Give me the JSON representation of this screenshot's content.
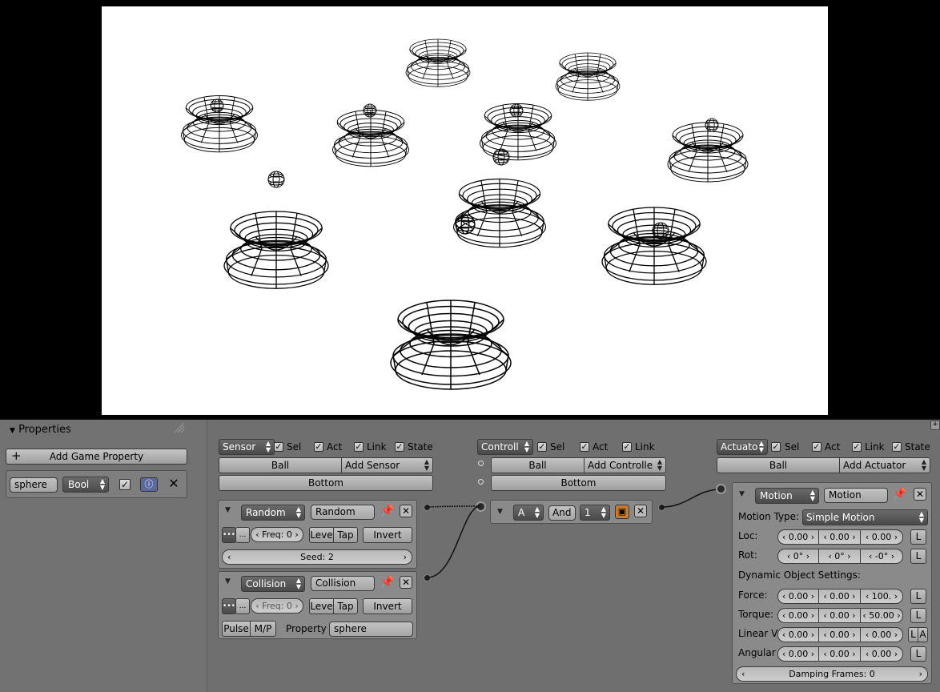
{
  "properties": {
    "title": "Properties",
    "add_button": "Add Game Property",
    "prop_name": "sphere",
    "prop_type": "Bool",
    "prop_value": true
  },
  "sensor": {
    "header_label": "Sensor",
    "sel": "Sel",
    "act": "Act",
    "link": "Link",
    "state": "State",
    "object": "Ball",
    "add": "Add Sensor",
    "sub": "Bottom",
    "items": [
      {
        "type": "Random",
        "name": "Random",
        "freq": "Freq: 0",
        "level": "Leve",
        "tap": "Tap",
        "invert": "Invert",
        "seed": "Seed: 2"
      },
      {
        "type": "Collision",
        "name": "Collision",
        "freq": "Freq: 0",
        "level": "Leve",
        "tap": "Tap",
        "invert": "Invert",
        "pulse": "Pulse",
        "mp": "M/P",
        "prop_label": "Property",
        "prop_value": "sphere"
      }
    ]
  },
  "controller": {
    "header_label": "Controll",
    "sel": "Sel",
    "act": "Act",
    "link": "Link",
    "object": "Ball",
    "add": "Add Controlle",
    "sub": "Bottom",
    "item": {
      "name": "A",
      "type": "And",
      "state": "1"
    }
  },
  "actuator": {
    "header_label": "Actuato",
    "sel": "Sel",
    "act": "Act",
    "link": "Link",
    "state": "State",
    "object": "Ball",
    "add": "Add Actuator",
    "item": {
      "type": "Motion",
      "name": "Motion",
      "motion_type_label": "Motion Type:",
      "motion_type": "Simple Motion",
      "loc_label": "Loc:",
      "loc": [
        "0.00",
        "0.00",
        "0.00"
      ],
      "rot_label": "Rot:",
      "rot": [
        "0°",
        "0°",
        "-0°"
      ],
      "dyn_label": "Dynamic Object Settings:",
      "force_label": "Force:",
      "force": [
        "0.00",
        "0.00",
        "100."
      ],
      "torque_label": "Torque:",
      "torque": [
        "0.00",
        "0.00",
        "50.00"
      ],
      "linv_label": "Linear V",
      "linv": [
        "0.00",
        "0.00",
        "0.00"
      ],
      "ang_label": "Angular",
      "ang": [
        "0.00",
        "0.00",
        "0.00"
      ],
      "l": "L",
      "a": "A",
      "damping": "Damping Frames: 0"
    }
  }
}
